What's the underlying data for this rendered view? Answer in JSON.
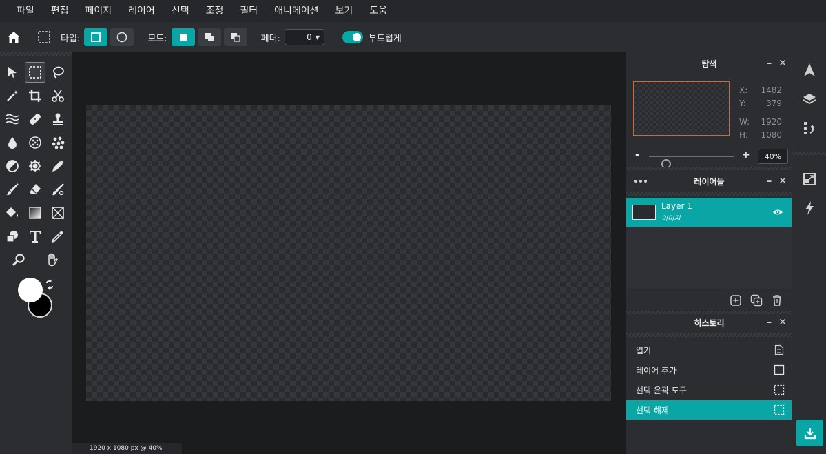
{
  "menu": [
    "파일",
    "편집",
    "페이지",
    "레이어",
    "선택",
    "조정",
    "필터",
    "애니메이션",
    "보기",
    "도움"
  ],
  "options": {
    "type_label": "타입:",
    "mode_label": "모드:",
    "feather_label": "페더:",
    "feather_value": "0",
    "smooth_label": "부드럽게",
    "smooth_on": true,
    "selected_type": "rectangle",
    "selected_mode": "new"
  },
  "status": {
    "text": "1920 x 1080 px @ 40%"
  },
  "navigator": {
    "title": "탐색",
    "x_label": "X:",
    "x_value": "1482",
    "y_label": "Y:",
    "y_value": "379",
    "w_label": "W:",
    "w_value": "1920",
    "h_label": "H:",
    "h_value": "1080",
    "zoom_minus": "-",
    "zoom_plus": "+",
    "zoom_value": "40%",
    "zoom_level": 0.1
  },
  "layers": {
    "title": "레이어들",
    "items": [
      {
        "name": "Layer 1",
        "type": "이미지",
        "visible": true
      }
    ]
  },
  "history": {
    "title": "히스토리",
    "items": [
      {
        "label": "열기",
        "icon": "document-icon",
        "active": false
      },
      {
        "label": "레이어 추가",
        "icon": "square-icon",
        "active": false
      },
      {
        "label": "선택 윤곽 도구",
        "icon": "marquee-icon",
        "active": false
      },
      {
        "label": "선택 해제",
        "icon": "marquee-icon",
        "active": true
      }
    ]
  },
  "colors": {
    "accent": "#0aa6a6",
    "foreground": "#ffffff",
    "background": "#000000",
    "nav_frame": "#e0622b"
  },
  "panel_controls": {
    "minimize": "–",
    "close": "✕"
  }
}
